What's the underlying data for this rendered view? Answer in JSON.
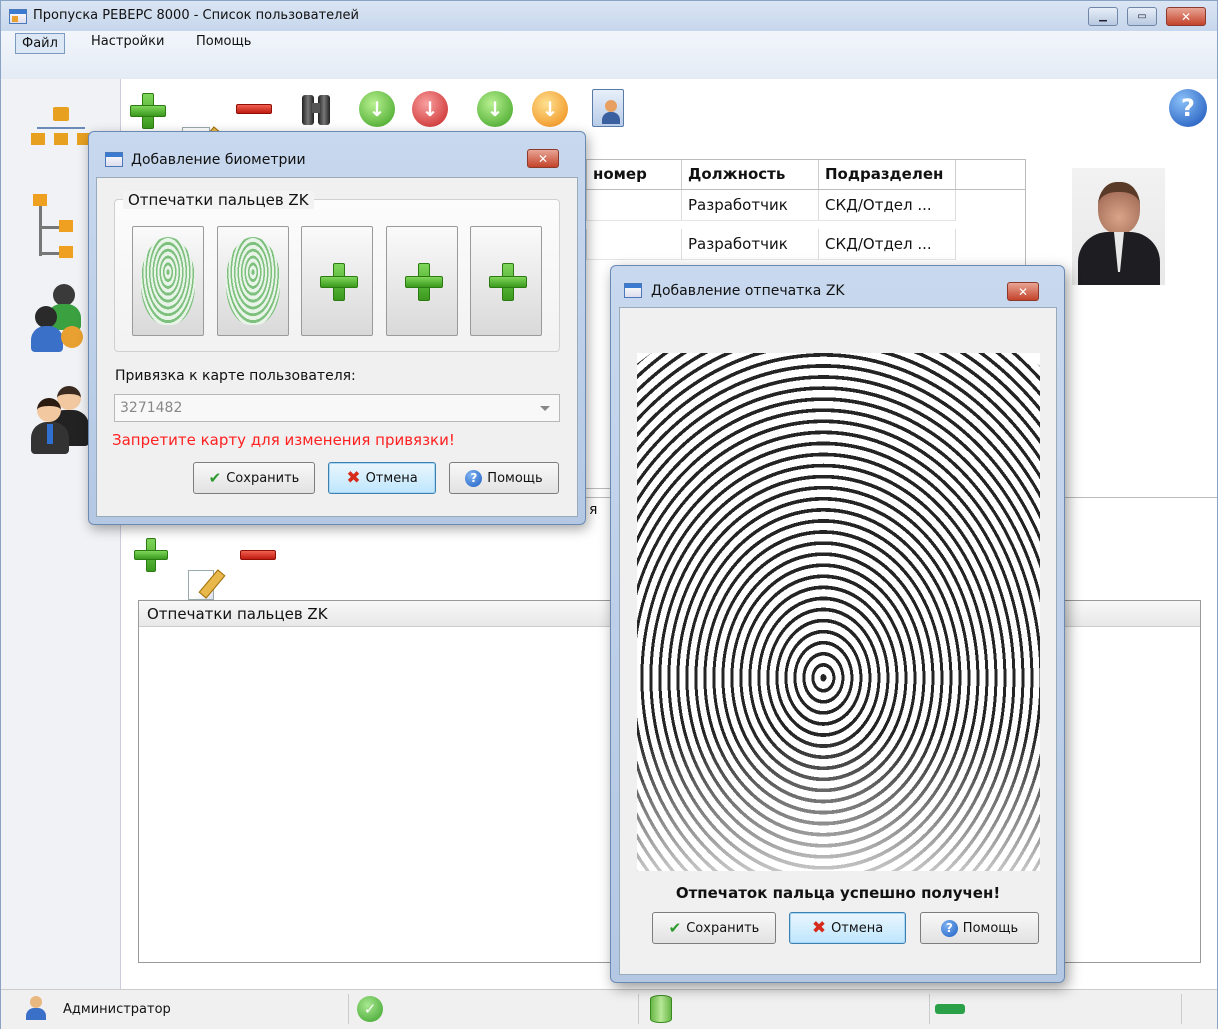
{
  "window": {
    "title": "Пропуска РЕВЕРС 8000 - Список пользователей"
  },
  "menu": [
    "Файл",
    "Настройки",
    "Помощь"
  ],
  "sidebar_icons": [
    "org-structure-icon",
    "tree-icon",
    "user-groups-icon",
    "users-icon"
  ],
  "toolbar_icons": [
    "add-icon",
    "edit-icon",
    "delete-icon",
    "search-binoculars-icon",
    "import-icon",
    "export-icon",
    "download-icon",
    "upload-icon",
    "contacts-icon",
    "help-icon"
  ],
  "table": {
    "headers": [
      "номер",
      "Должность",
      "Подразделен"
    ],
    "rows": [
      [
        "",
        "Разработчик",
        "СКД/Отдел ..."
      ],
      [
        "",
        "Разработчик",
        "СКД/Отдел ..."
      ]
    ]
  },
  "photo_label": "user-photo",
  "lower_panel": {
    "tab_fragment": "я",
    "list_header": "Отпечатки пальцев ZK"
  },
  "dialog_bio": {
    "title": "Добавление биометрии",
    "group_title": "Отпечатки пальцев ZK",
    "slots": [
      "captured",
      "captured",
      "empty",
      "empty",
      "empty"
    ],
    "card_label": "Привязка к карте пользователя:",
    "card_value": "3271482",
    "warning": "Запретите карту для изменения привязки!",
    "warning_color": "#ff2020",
    "save": "Сохранить",
    "cancel": "Отмена",
    "help": "Помощь"
  },
  "dialog_fp": {
    "title": "Добавление отпечатка ZK",
    "status": "Отпечаток пальца успешно получен!",
    "save": "Сохранить",
    "cancel": "Отмена",
    "help": "Помощь"
  },
  "statusbar": {
    "user": "Администратор"
  }
}
